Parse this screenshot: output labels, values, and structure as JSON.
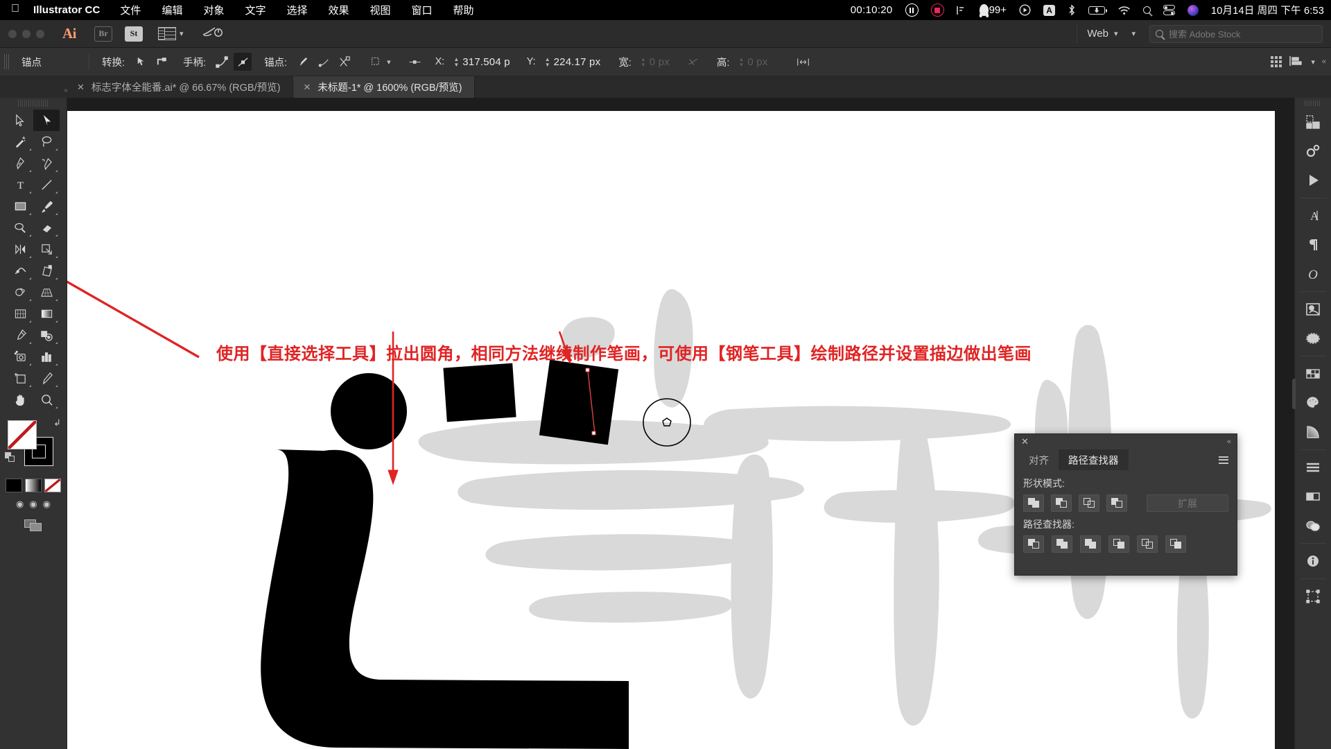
{
  "macbar": {
    "app_name": "Illustrator CC",
    "menus": [
      "文件",
      "编辑",
      "对象",
      "文字",
      "选择",
      "效果",
      "视图",
      "窗口",
      "帮助"
    ],
    "recording_time": "00:10:20",
    "notification_count": "99+",
    "input_source": "A",
    "datetime": "10月14日 周四 下午 6:53",
    "icons": [
      "apple-icon",
      "pause-icon",
      "record-icon",
      "airplay-icon",
      "qq-icon",
      "screen-record-icon",
      "input-source-icon",
      "bluetooth-icon",
      "battery-icon",
      "wifi-icon",
      "spotlight-icon",
      "control-center-icon",
      "siri-icon"
    ]
  },
  "appbar": {
    "logo": "Ai",
    "bridge_label": "Br",
    "stock_label": "St",
    "workspace": "Web",
    "search_placeholder": "搜索 Adobe Stock"
  },
  "controlbar": {
    "title": "锚点",
    "convert_label": "转换:",
    "handle_label": "手柄:",
    "anchor_label": "锚点:",
    "x_label": "X:",
    "x_value": "317.504 p",
    "y_label": "Y:",
    "y_value": "224.17 px",
    "w_label": "宽:",
    "w_value": "0 px",
    "h_label": "高:",
    "h_value": "0 px"
  },
  "tabs": [
    {
      "label": "标志字体全能番.ai* @ 66.67% (RGB/预览)",
      "active": false
    },
    {
      "label": "未标题-1* @ 1600% (RGB/预览)",
      "active": true
    }
  ],
  "toolbar": {
    "tools": [
      {
        "name": "selection-tool",
        "selected": false
      },
      {
        "name": "direct-selection-tool",
        "selected": true
      },
      {
        "name": "magic-wand-tool",
        "selected": false
      },
      {
        "name": "lasso-tool",
        "selected": false
      },
      {
        "name": "pen-tool",
        "selected": false
      },
      {
        "name": "curvature-tool",
        "selected": false
      },
      {
        "name": "type-tool",
        "selected": false
      },
      {
        "name": "line-segment-tool",
        "selected": false
      },
      {
        "name": "rectangle-tool",
        "selected": false
      },
      {
        "name": "paintbrush-tool",
        "selected": false
      },
      {
        "name": "shaper-tool",
        "selected": false
      },
      {
        "name": "eraser-tool",
        "selected": false
      },
      {
        "name": "rotate-tool",
        "selected": false
      },
      {
        "name": "scale-tool",
        "selected": false
      },
      {
        "name": "width-tool",
        "selected": false
      },
      {
        "name": "free-transform-tool",
        "selected": false
      },
      {
        "name": "shape-builder-tool",
        "selected": false
      },
      {
        "name": "perspective-grid-tool",
        "selected": false
      },
      {
        "name": "mesh-tool",
        "selected": false
      },
      {
        "name": "gradient-tool",
        "selected": false
      },
      {
        "name": "eyedropper-tool",
        "selected": false
      },
      {
        "name": "blend-tool",
        "selected": false
      },
      {
        "name": "symbol-sprayer-tool",
        "selected": false
      },
      {
        "name": "column-graph-tool",
        "selected": false
      },
      {
        "name": "artboard-tool",
        "selected": false
      },
      {
        "name": "slice-tool",
        "selected": false
      },
      {
        "name": "hand-tool",
        "selected": false
      },
      {
        "name": "zoom-tool",
        "selected": false
      }
    ]
  },
  "annotation": {
    "text": "使用【直接选择工具】拉出圆角，相同方法继续制作笔画，可使用【钢笔工具】绘制路径并设置描边做出笔画",
    "color": "#e02424"
  },
  "pathfinder": {
    "tab_align": "对齐",
    "tab_pathfinder": "路径查找器",
    "shape_modes_label": "形状模式:",
    "pathfinder_label": "路径查找器:",
    "expand_label": "扩展",
    "shape_mode_buttons": [
      "unite-icon",
      "minus-front-icon",
      "intersect-icon",
      "exclude-icon"
    ],
    "pathfinder_buttons": [
      "divide-icon",
      "trim-icon",
      "merge-icon",
      "crop-icon",
      "outline-icon",
      "minus-back-icon"
    ]
  },
  "rightdock": {
    "groups": [
      [
        "artboards-icon",
        "properties-icon",
        "actions-icon"
      ],
      [
        "character-icon",
        "paragraph-icon",
        "glyphs-icon"
      ],
      [
        "symbols-icon",
        "brushes-icon"
      ],
      [
        "swatches-icon",
        "color-icon",
        "gradient-icon"
      ],
      [
        "layers-icon",
        "appearance-icon",
        "transparency-icon"
      ],
      [
        "info-icon"
      ],
      [
        "transform-icon"
      ]
    ]
  }
}
